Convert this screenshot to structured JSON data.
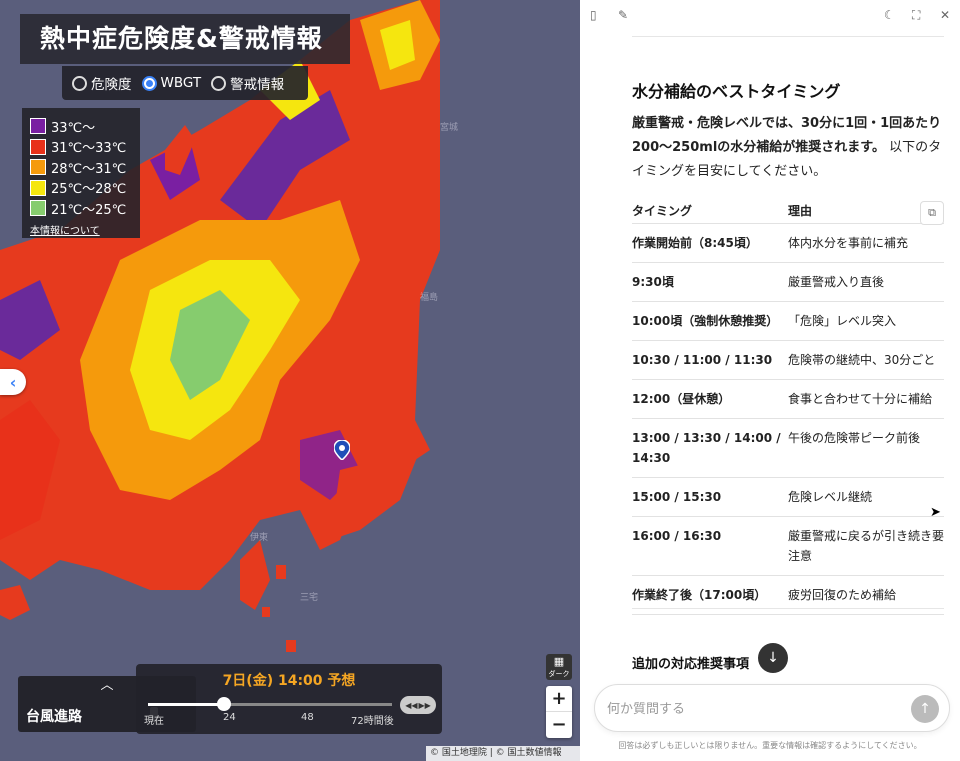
{
  "map": {
    "title": "熱中症危険度&警戒情報",
    "modes": [
      {
        "label": "危険度",
        "selected": false
      },
      {
        "label": "WBGT",
        "selected": true
      },
      {
        "label": "警戒情報",
        "selected": false
      }
    ],
    "legend": [
      {
        "label": "33℃〜",
        "color": "#7a1fa2"
      },
      {
        "label": "31℃〜33℃",
        "color": "#e8311a"
      },
      {
        "label": "28℃〜31℃",
        "color": "#f59a0c"
      },
      {
        "label": "25℃〜28℃",
        "color": "#f5e60f"
      },
      {
        "label": "21℃〜25℃",
        "color": "#86cc6e"
      }
    ],
    "legend_link": "本情報について",
    "typhoon_label": "台風進路",
    "timebar": {
      "title": "7日(金) 14:00 予想",
      "ticks": [
        "現在",
        "24",
        "48",
        "72時間後"
      ],
      "position_fraction": 0.31
    },
    "dark_label": "ダーク",
    "zoom_in": "+",
    "zoom_out": "−",
    "attribution": "© 国土地理院 | © 国土数値情報"
  },
  "panel": {
    "section_title": "水分補給のベストタイミング",
    "intro_bold": "厳重警戒・危険レベルでは、30分に1回・1回あたり200〜250mlの水分補給が推奨されます。",
    "intro_rest": "以下のタイミングを目安にしてください。",
    "table": {
      "headers": [
        "タイミング",
        "理由"
      ],
      "rows": [
        [
          "作業開始前（8:45頃）",
          "体内水分を事前に補充"
        ],
        [
          "9:30頃",
          "厳重警戒入り直後"
        ],
        [
          "10:00頃（強制休憩推奨）",
          "「危険」レベル突入"
        ],
        [
          "10:30 / 11:00 / 11:30",
          "危険帯の継続中、30分ごと"
        ],
        [
          "12:00（昼休憩）",
          "食事と合わせて十分に補給"
        ],
        [
          "13:00 / 13:30 / 14:00 / 14:30",
          "午後の危険帯ピーク前後"
        ],
        [
          "15:00 / 15:30",
          "危険レベル継続"
        ],
        [
          "16:00 / 16:30",
          "厳重警戒に戻るが引き続き要注意"
        ],
        [
          "作業終了後（17:00頃）",
          "疲労回復のため補給"
        ]
      ]
    },
    "next_section_title": "追加の対応推奨事項",
    "chat_placeholder": "何か質問する",
    "disclaimer": "回答は必ずしも正しいとは限りません。重要な情報は確認するようにしてください。"
  }
}
